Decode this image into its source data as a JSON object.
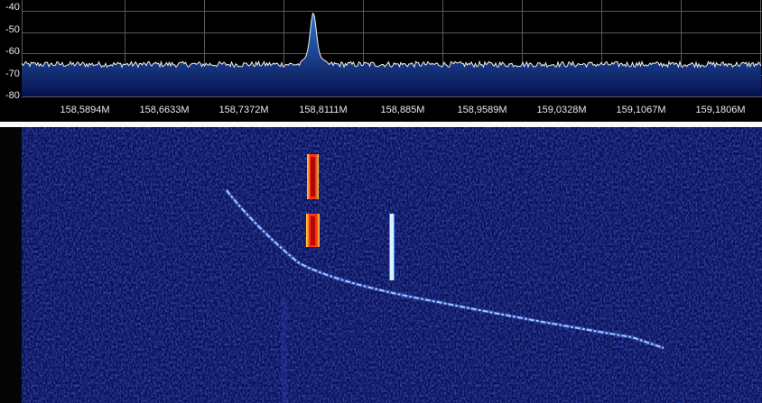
{
  "spectrum": {
    "db_scale": [
      "-40",
      "-50",
      "-60",
      "-70",
      "-80"
    ],
    "frequencies": [
      "158,5894M",
      "158,6633M",
      "158,7372M",
      "158,8111M",
      "158,885M",
      "158,9589M",
      "159,0328M",
      "159,1067M",
      "159,1806M"
    ],
    "noise_floor_db": -64,
    "peak_db": -45,
    "peak_frequency": "158,8111M"
  },
  "colors": {
    "background": "#000000",
    "grid": "#5a5a5a",
    "trace": "#f0f0f0",
    "fill_top": "#2f73c8",
    "fill_bottom": "#0b1a6e",
    "waterfall_bg": "#0a0f55",
    "signal_hot": "#ff4a1a",
    "signal_cold": "#bfe4ff"
  },
  "waterfall": {
    "colormap": "blue-to-red"
  }
}
